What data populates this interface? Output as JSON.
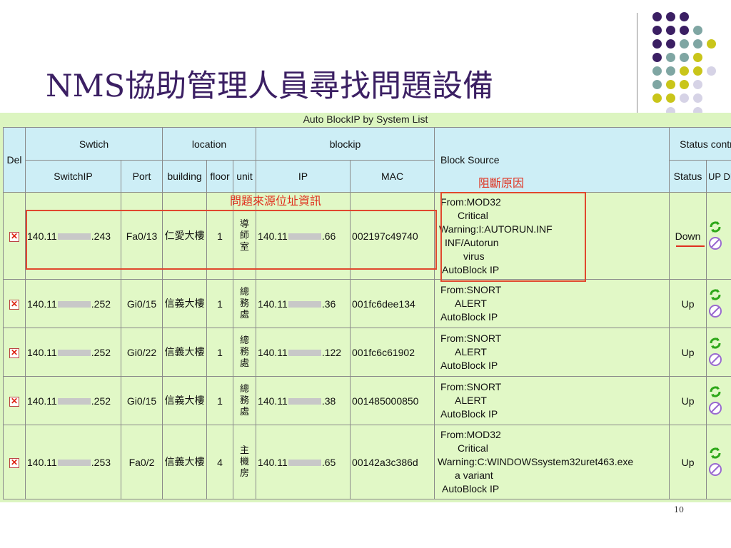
{
  "slide": {
    "title": "NMS協助管理人員尋找問題設備",
    "page_number": "10"
  },
  "table": {
    "title": "Auto BlockIP by System List",
    "headers": {
      "del": "Del",
      "switch_group": "Swtich",
      "location_group": "location",
      "blockip_group": "blockip",
      "block_source": "Block Source",
      "status_group": "Status contrl",
      "switch_ip": "SwitchIP",
      "port": "Port",
      "building": "building",
      "floor": "floor",
      "unit": "unit",
      "ip": "IP",
      "mac": "MAC",
      "status": "Status",
      "updn": "UP DN"
    },
    "rows": [
      {
        "switch_ip_prefix": "140.11",
        "switch_ip_suffix": ".243",
        "port": "Fa0/13",
        "building": "仁愛大樓",
        "floor": "1",
        "unit": "導師室",
        "ip_prefix": "140.11",
        "ip_suffix": ".66",
        "mac": "002197c49740",
        "source": [
          "From:MOD32",
          "Critical",
          "Warning:I:AUTORUN.INF",
          "INF/Autorun",
          "virus",
          "AutoBlock IP"
        ],
        "status": "Down"
      },
      {
        "switch_ip_prefix": "140.11",
        "switch_ip_suffix": ".252",
        "port": "Gi0/15",
        "building": "信義大樓",
        "floor": "1",
        "unit": "總務處",
        "ip_prefix": "140.11",
        "ip_suffix": ".36",
        "mac": "001fc6dee134",
        "source": [
          "From:SNORT",
          "ALERT",
          "AutoBlock IP"
        ],
        "status": "Up"
      },
      {
        "switch_ip_prefix": "140.11",
        "switch_ip_suffix": ".252",
        "port": "Gi0/22",
        "building": "信義大樓",
        "floor": "1",
        "unit": "總務處",
        "ip_prefix": "140.11",
        "ip_suffix": ".122",
        "mac": "001fc6c61902",
        "source": [
          "From:SNORT",
          "ALERT",
          "AutoBlock IP"
        ],
        "status": "Up"
      },
      {
        "switch_ip_prefix": "140.11",
        "switch_ip_suffix": ".252",
        "port": "Gi0/15",
        "building": "信義大樓",
        "floor": "1",
        "unit": "總務處",
        "ip_prefix": "140.11",
        "ip_suffix": ".38",
        "mac": "001485000850",
        "source": [
          "From:SNORT",
          "ALERT",
          "AutoBlock IP"
        ],
        "status": "Up"
      },
      {
        "switch_ip_prefix": "140.11",
        "switch_ip_suffix": ".253",
        "port": "Fa0/2",
        "building": "信義大樓",
        "floor": "4",
        "unit": "主機房",
        "ip_prefix": "140.11",
        "ip_suffix": ".65",
        "mac": "00142a3c386d",
        "source": [
          "From:MOD32",
          "Critical",
          "Warning:C:WINDOWSsystem32uret463.exe",
          "a variant",
          "AutoBlock IP"
        ],
        "status": "Up"
      }
    ]
  },
  "annotations": {
    "block_reason": "阻斷原因",
    "source_info": "問題來源位址資訊"
  },
  "icons": {
    "delete": "delete-x-icon",
    "refresh": "refresh-up-icon",
    "block": "block-dn-icon"
  },
  "colors": {
    "title": "#3b1f63",
    "panel_bg": "#dcf5c0",
    "header_bg": "#cdeef6",
    "annotation_red": "#e0301e",
    "dot_purple": "#3b1f63",
    "dot_teal": "#7fa6a3",
    "dot_yellow": "#c9c51a",
    "dot_lavender": "#d6d3e6"
  }
}
